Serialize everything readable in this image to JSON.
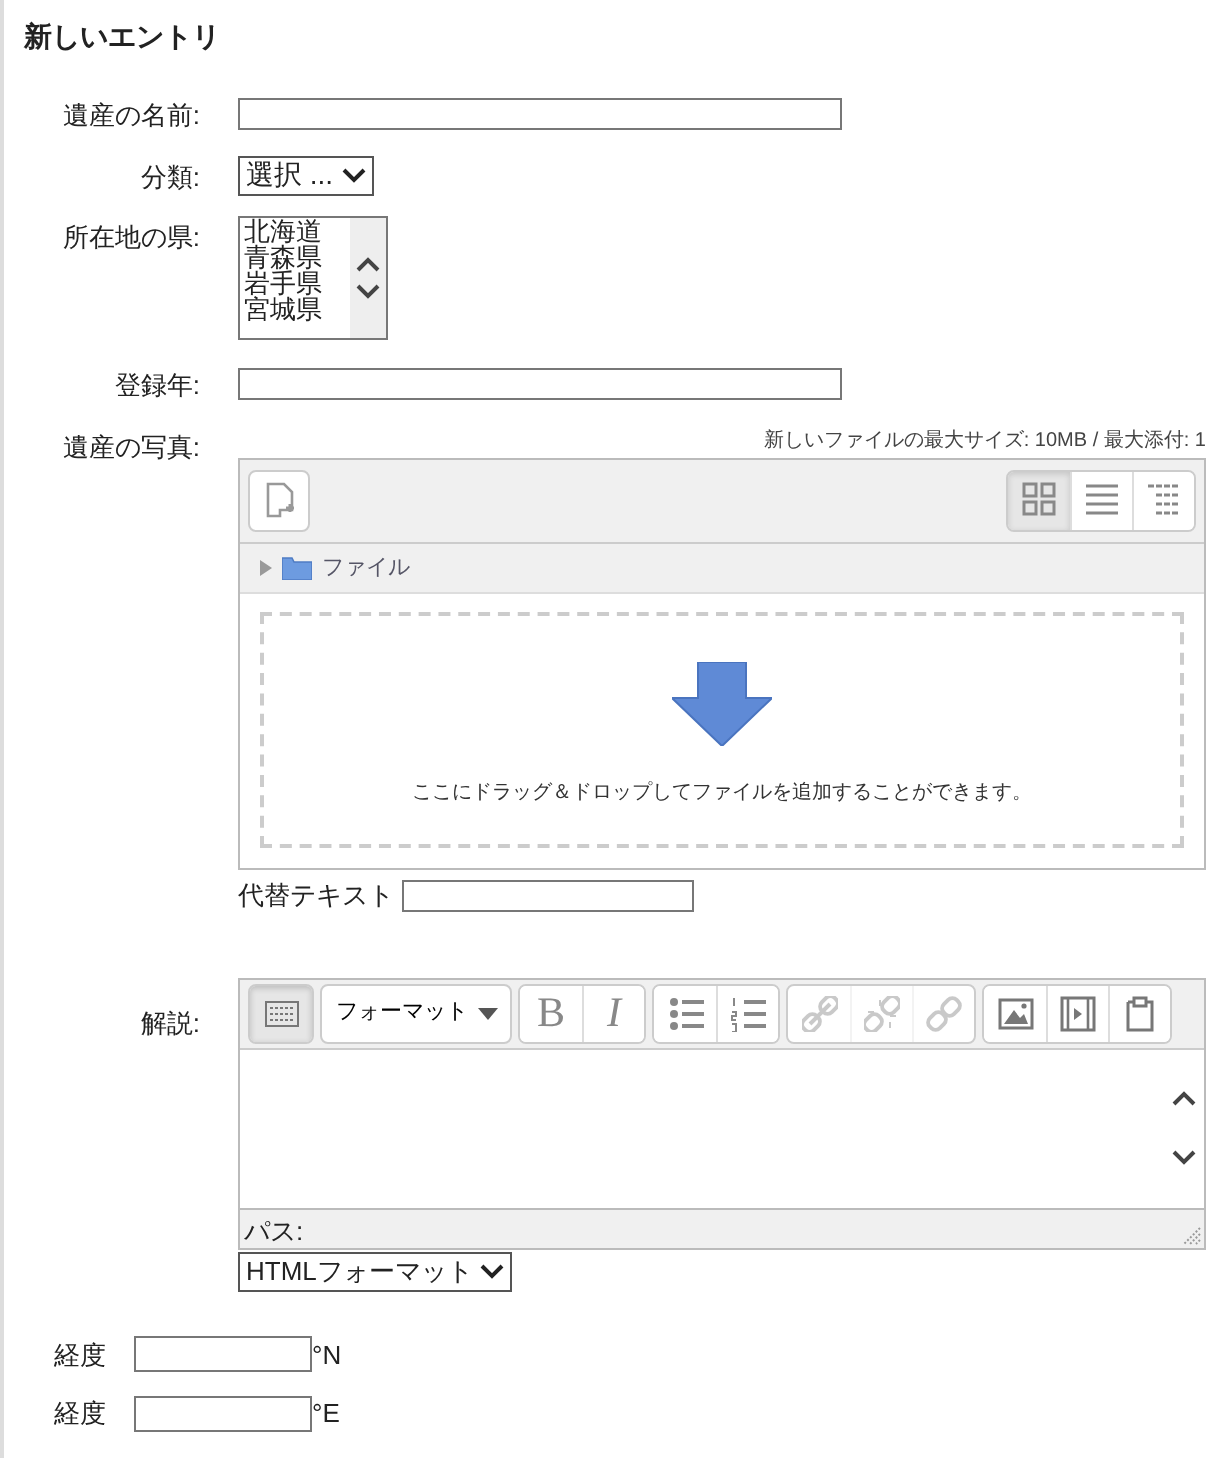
{
  "title": "新しいエントリ",
  "fields": [
    {
      "kind": "text",
      "label": "遺産の名前:"
    },
    {
      "kind": "select",
      "label": "分類:",
      "value": "選択 ..."
    },
    {
      "kind": "listbox",
      "label": "所在地の県:",
      "options": [
        "北海道",
        "青森県",
        "岩手県",
        "宮城県"
      ]
    },
    {
      "kind": "text",
      "label": "登録年:"
    },
    {
      "kind": "filepicker",
      "label": "遺産の写真:",
      "limits": "新しいファイルの最大サイズ: 10MB / 最大添付: 1",
      "views": [
        {
          "selected": true
        },
        {
          "selected": false
        },
        {
          "selected": false
        }
      ],
      "folder": "ファイル",
      "drop_hint": "ここにドラッグ＆ドロップしてファイルを追加することができます。",
      "alt_label": "代替テキスト"
    },
    {
      "kind": "editor",
      "label": "解説:",
      "toolbar": [
        {
          "kind": "toggle",
          "pressed": true
        },
        {
          "kind": "dropdown",
          "label": "フォーマット"
        },
        {
          "kind": "group",
          "buttons": [
            {
              "text": "B",
              "disabled": false
            },
            {
              "text": "I",
              "disabled": false
            }
          ]
        },
        {
          "kind": "group",
          "buttons": [
            {
              "disabled": false
            },
            {
              "disabled": false
            }
          ]
        },
        {
          "kind": "group",
          "buttons": [
            {
              "disabled": true
            },
            {
              "disabled": true
            },
            {
              "disabled": true
            }
          ]
        },
        {
          "kind": "group",
          "buttons": [
            {
              "disabled": false
            },
            {
              "disabled": false
            },
            {
              "disabled": false
            }
          ]
        }
      ],
      "path_label": "パス:",
      "format": "HTMLフォーマット"
    }
  ],
  "coords": [
    {
      "label": "経度",
      "unit": "°N"
    },
    {
      "label": "経度",
      "unit": "°E"
    }
  ]
}
